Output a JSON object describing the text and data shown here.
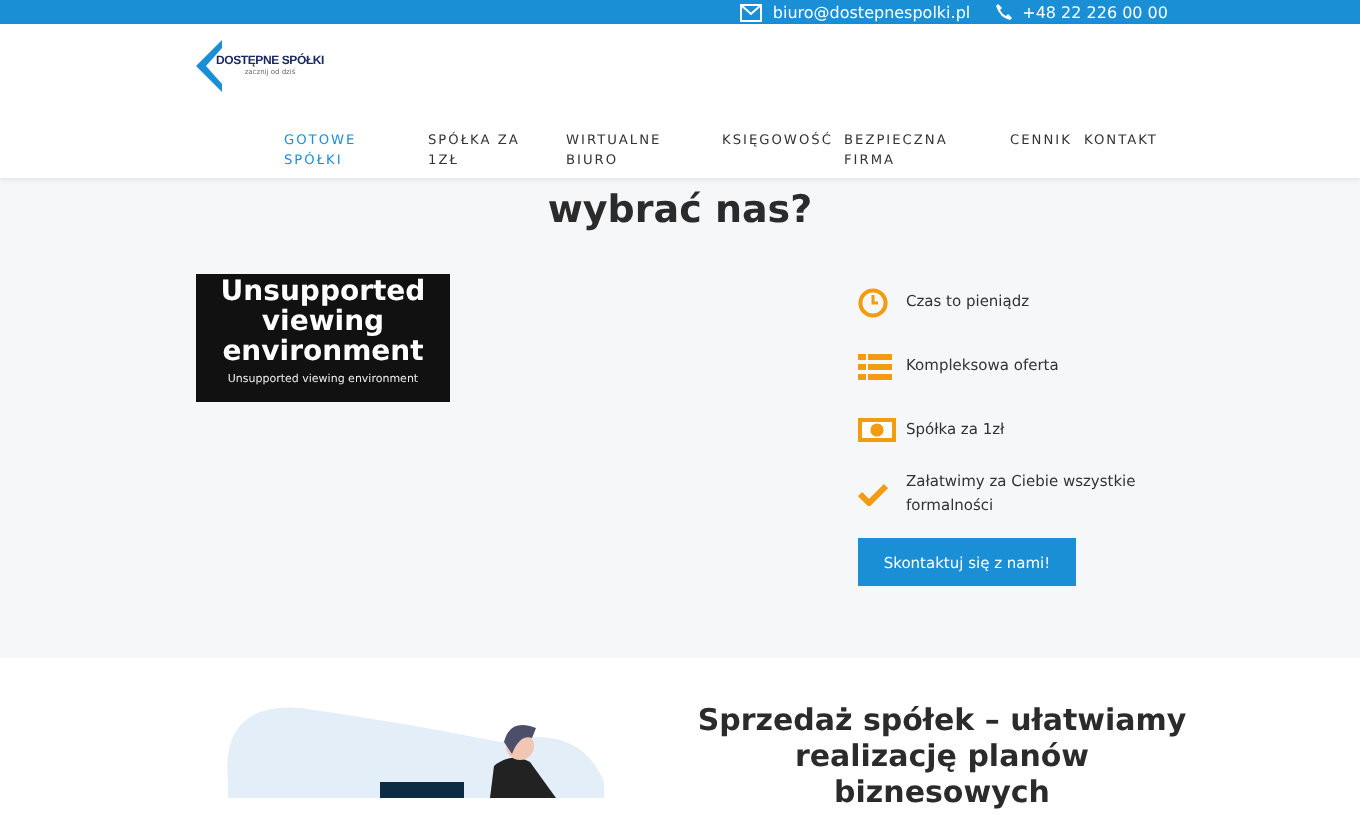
{
  "top_bar": {
    "email": "biuro@dostepnespolki.pl",
    "phone": "+48 22 226 00 00"
  },
  "logo": {
    "name": "DOSTĘPNE SPÓŁKI",
    "tagline": "zacznij od dziś"
  },
  "nav": [
    {
      "label": "GOTOWE SPÓŁKI",
      "selected": true
    },
    {
      "label": "SPÓŁKA ZA 1ZŁ",
      "selected": false
    },
    {
      "label": "WIRTUALNE BIURO",
      "selected": false
    },
    {
      "label": "KSIĘGOWOŚĆ",
      "selected": false
    },
    {
      "label": "BEZPIECZNA FIRMA",
      "selected": false
    },
    {
      "label": "CENNIK",
      "selected": false
    },
    {
      "label": "KONTAKT",
      "selected": false
    }
  ],
  "why": {
    "heading": "wybrać nas?",
    "video": {
      "message": "Unsupported viewing environment",
      "caption": "Unsupported viewing environment"
    },
    "features": [
      {
        "kind": "clock",
        "text": "Czas to pieniądz"
      },
      {
        "kind": "list",
        "text": "Kompleksowa oferta"
      },
      {
        "kind": "money",
        "text": "Spółka za 1zł"
      },
      {
        "kind": "check",
        "text": "Załatwimy za Ciebie wszystkie formalności"
      }
    ],
    "button": "Skontaktuj się z nami!"
  },
  "sale": {
    "heading": "Sprzedaż spółek – ułatwiamy realizację planów biznesowych"
  }
}
